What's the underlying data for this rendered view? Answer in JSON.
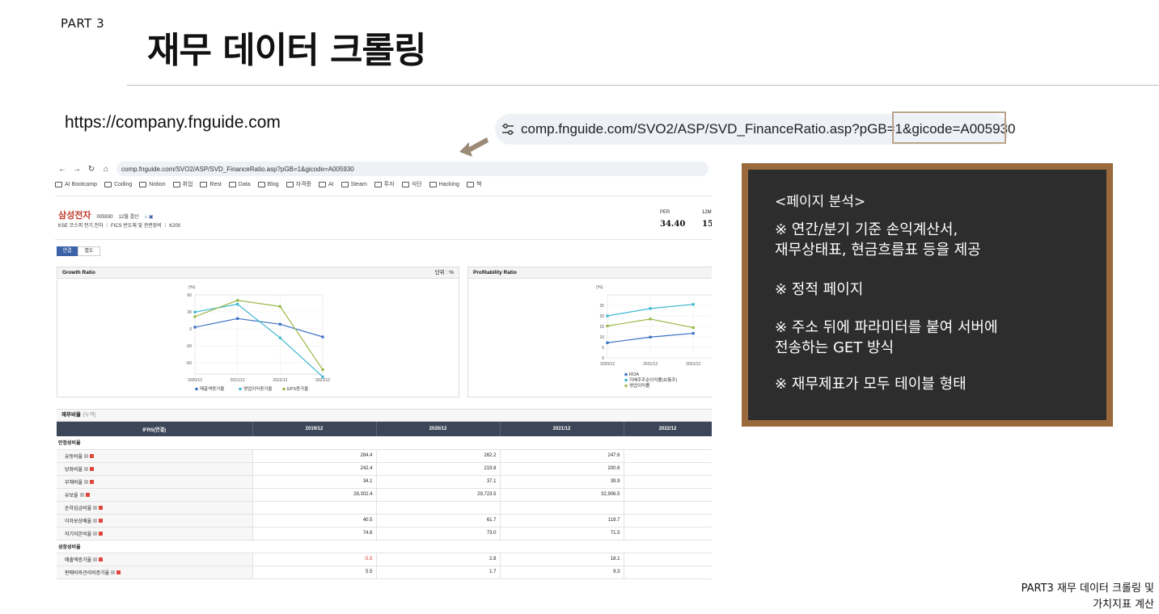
{
  "slide": {
    "part": "PART 3",
    "title": "재무 데이터 크롤링",
    "site_url": "https://company.fnguide.com",
    "address_bar": "comp.fnguide.com/SVO2/ASP/SVD_FinanceRatio.asp?pGB=1&gicode=A005930",
    "footer_line1": "PART3 재무 데이터 크롤링 및",
    "footer_line2": "가치지표 계산"
  },
  "browser": {
    "url": "comp.fnguide.com/SVO2/ASP/SVD_FinanceRatio.asp?pGB=1&gicode=A005930",
    "bookmarks": [
      "AI Bootcamp",
      "Coding",
      "Notion",
      "취업",
      "Rest",
      "Data",
      "Blog",
      "자격증",
      "AI",
      "Steam",
      "투자",
      "식단",
      "Hacking",
      "책"
    ]
  },
  "company": {
    "name": "삼성전자",
    "code": "005930",
    "settle": "12월 결산",
    "market": "KSE  코스피 전기,전자",
    "fics": "FICS 반도체 및 관련장비",
    "index": "K200",
    "per_label": "PER",
    "per_value": "34.40",
    "per2_label": "12M",
    "per2_value": "15"
  },
  "tabs": {
    "consolidated": "연결",
    "separate": "별도"
  },
  "growth_panel": {
    "title": "Growth Ratio",
    "unit": "단위 : %",
    "unit_label": "(%)",
    "legend": [
      "매출액증가율",
      "영업이익증가율",
      "EPS증가율"
    ]
  },
  "profit_panel": {
    "title": "Profitability Ratio",
    "unit_label": "(%)",
    "legend": [
      "ROA",
      "지배주주순이익률(보통주)",
      "영업이익률"
    ]
  },
  "chart_data": [
    {
      "type": "line",
      "title": "Growth Ratio",
      "x": [
        "2020/12",
        "2021/12",
        "2022/12",
        "2023/12"
      ],
      "ylim": [
        -80,
        60
      ],
      "yticks": [
        60,
        30,
        0,
        -30,
        -60
      ],
      "series": [
        {
          "name": "매출액증가율",
          "values": [
            2.8,
            18.1,
            8.1,
            -14.3
          ],
          "color": "#3a6fc4"
        },
        {
          "name": "영업이익증가율",
          "values": [
            29.6,
            43.5,
            -16.0,
            -84.9
          ],
          "color": "#3db7d0"
        },
        {
          "name": "EPS증가율",
          "values": [
            21.5,
            50.3,
            39.5,
            -72.2
          ],
          "color": "#9ab84a"
        }
      ]
    },
    {
      "type": "line",
      "title": "Profitability Ratio",
      "x": [
        "2020/12",
        "2021/12",
        "2022/12"
      ],
      "ylim": [
        0,
        30
      ],
      "yticks": [
        25,
        20,
        15,
        10,
        5,
        0
      ],
      "series": [
        {
          "name": "ROA",
          "values": [
            7.2,
            9.9,
            11.7
          ],
          "color": "#3a6fc4"
        },
        {
          "name": "지배주주순이익률(보통주)",
          "values": [
            20.0,
            23.5,
            25.5
          ],
          "color": "#3db7d0"
        },
        {
          "name": "영업이익률",
          "values": [
            15.2,
            18.5,
            14.4
          ],
          "color": "#9ab84a"
        }
      ]
    }
  ],
  "fin_table": {
    "title": "재무비율",
    "tag": "[누적]",
    "headers": [
      "IFRS(연결)",
      "2019/12",
      "2020/12",
      "2021/12",
      "2022/12"
    ],
    "group1": "안정성비율",
    "group2": "성장성비율",
    "rows": [
      {
        "label": "유동비율",
        "v": [
          "284.4",
          "262.2",
          "247.6",
          ""
        ]
      },
      {
        "label": "당좌비율",
        "v": [
          "242.4",
          "219.8",
          "200.6",
          ""
        ]
      },
      {
        "label": "부채비율",
        "v": [
          "34.1",
          "37.1",
          "39.9",
          ""
        ]
      },
      {
        "label": "유보율",
        "v": [
          "28,302.4",
          "29,723.5",
          "32,906.5",
          ""
        ]
      },
      {
        "label": "순차입금비율",
        "v": [
          "",
          "",
          "",
          ""
        ]
      },
      {
        "label": "이자보상배율",
        "v": [
          "40.5",
          "61.7",
          "119.7",
          ""
        ]
      },
      {
        "label": "자기자본비율",
        "v": [
          "74.6",
          "73.0",
          "71.5",
          ""
        ]
      },
      {
        "label": "매출액증가율",
        "v": [
          "-5.5",
          "2.8",
          "18.1",
          ""
        ]
      },
      {
        "label": "판매비와관리비증가율",
        "v": [
          "5.5",
          "1.7",
          "9.3",
          ""
        ]
      }
    ]
  },
  "board": {
    "heading": "<페이지 분석>",
    "p1a": "※ 연간/분기 기준 손익계산서,",
    "p1b": "재무상태표, 현금흐름표 등을 제공",
    "p2": "※ 정적 페이지",
    "p3a": "※ 주소 뒤에 파라미터를 붙여 서버에",
    "p3b": "전송하는 GET 방식",
    "p4": "※ 재무제표가 모두 테이블 형태"
  },
  "colors": {
    "board_frame": "#9a6a3c",
    "board_bg": "#2d2d2d",
    "table_header": "#3b4658",
    "highlight_box": "#b9a58c"
  }
}
